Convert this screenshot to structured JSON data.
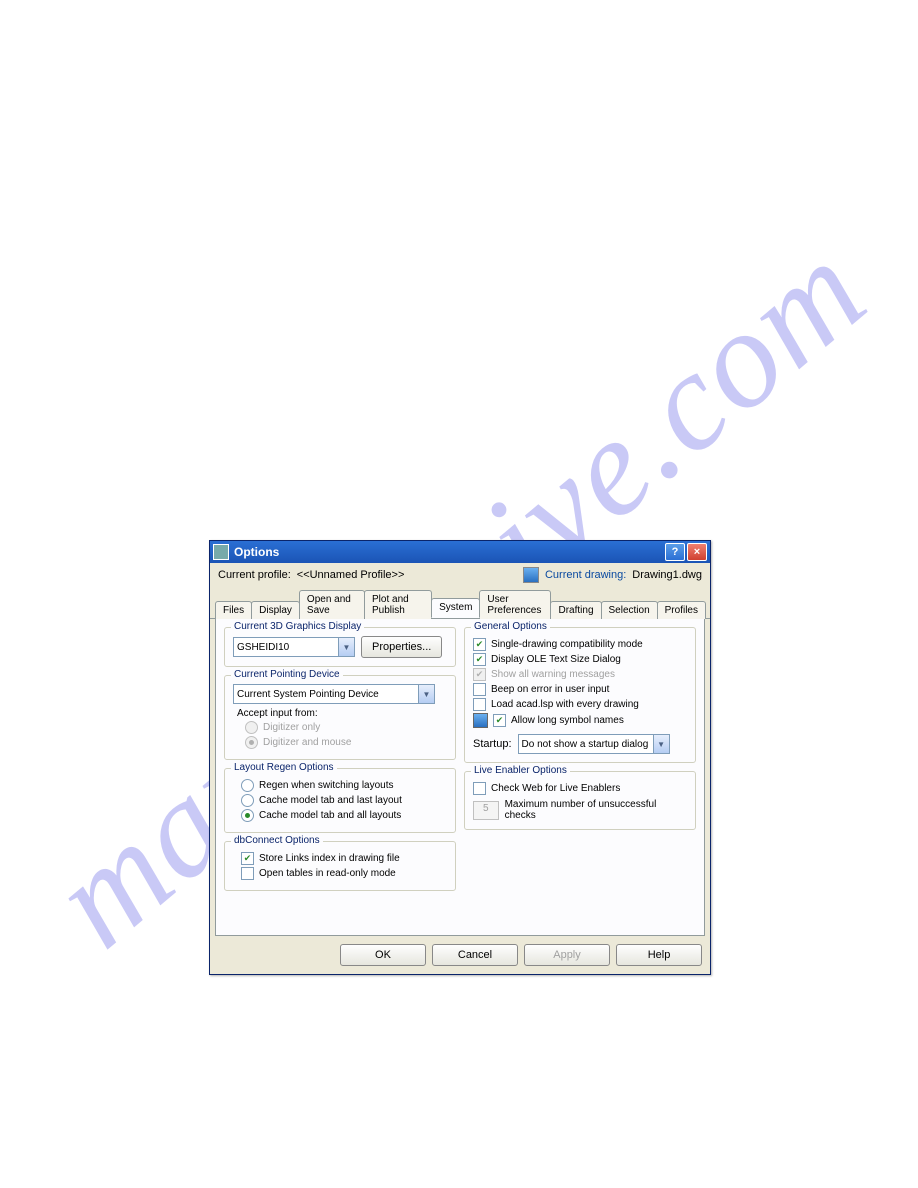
{
  "watermark": "manualshive.com",
  "window": {
    "title": "Options"
  },
  "header": {
    "profile_label": "Current profile:",
    "profile_value": "<<Unnamed Profile>>",
    "drawing_label": "Current drawing:",
    "drawing_value": "Drawing1.dwg"
  },
  "tabs": [
    "Files",
    "Display",
    "Open and Save",
    "Plot and Publish",
    "System",
    "User Preferences",
    "Drafting",
    "Selection",
    "Profiles"
  ],
  "graphics": {
    "legend": "Current 3D Graphics Display",
    "combo": "GSHEIDI10",
    "properties_btn": "Properties..."
  },
  "pointing": {
    "legend": "Current Pointing Device",
    "combo": "Current System Pointing Device",
    "accept_label": "Accept input from:",
    "r1": "Digitizer only",
    "r2": "Digitizer and mouse"
  },
  "regen": {
    "legend": "Layout Regen Options",
    "r1": "Regen when switching layouts",
    "r2": "Cache model tab and last layout",
    "r3": "Cache model tab and all layouts"
  },
  "dbc": {
    "legend": "dbConnect Options",
    "c1": "Store Links index in drawing file",
    "c2": "Open tables in read-only mode"
  },
  "general": {
    "legend": "General Options",
    "c1": "Single-drawing compatibility mode",
    "c2": "Display OLE Text Size Dialog",
    "c3": "Show all warning messages",
    "c4": "Beep on error in user input",
    "c5": "Load acad.lsp with every drawing",
    "c6": "Allow long symbol names",
    "startup_label": "Startup:",
    "startup_combo": "Do not show a startup dialog"
  },
  "live": {
    "legend": "Live Enabler Options",
    "c1": "Check Web for Live Enablers",
    "num": "5",
    "numlabel": "Maximum number of unsuccessful checks"
  },
  "buttons": {
    "ok": "OK",
    "cancel": "Cancel",
    "apply": "Apply",
    "help": "Help"
  }
}
